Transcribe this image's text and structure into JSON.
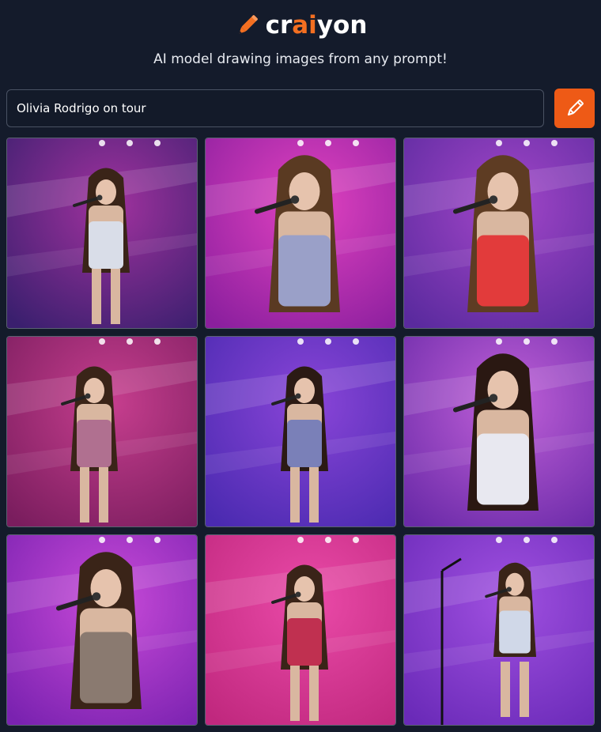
{
  "header": {
    "brand_prefix": "cr",
    "brand_ai": "ai",
    "brand_suffix": "yon",
    "tagline": "AI model drawing images from any prompt!",
    "logo_icon": "pencil-icon",
    "accent_color": "#f36f21"
  },
  "prompt": {
    "value": "Olivia Rodrigo on tour",
    "button_icon": "pencil-icon",
    "button_color": "#ee5a16"
  },
  "gallery": {
    "images": [
      {
        "id": "img-1",
        "bg": [
          "#3a1f6e",
          "#a0329e"
        ],
        "accent": "#c8d9f0",
        "pose": "standing",
        "hair": "#3a2418",
        "outfit": "#d9dde8"
      },
      {
        "id": "img-2",
        "bg": [
          "#8b1f9e",
          "#e142c0"
        ],
        "accent": "#ffffff",
        "pose": "closeup",
        "hair": "#5a3a22",
        "outfit": "#9aa0c8"
      },
      {
        "id": "img-3",
        "bg": [
          "#5a2a9e",
          "#a246c8"
        ],
        "accent": "#e23b3b",
        "pose": "closeup",
        "hair": "#5e3c23",
        "outfit": "#e23b3b"
      },
      {
        "id": "img-4",
        "bg": [
          "#7a1d5e",
          "#c63e8e"
        ],
        "accent": "#ffd0e0",
        "pose": "leaning",
        "hair": "#3a2418",
        "outfit": "#b07090"
      },
      {
        "id": "img-5",
        "bg": [
          "#4a2ab0",
          "#8a45d8"
        ],
        "accent": "#c9b8ff",
        "pose": "standing",
        "hair": "#2b1a14",
        "outfit": "#7a80b8"
      },
      {
        "id": "img-6",
        "bg": [
          "#6a2aa8",
          "#c060d8"
        ],
        "accent": "#f2f2f2",
        "pose": "closeup",
        "hair": "#2a1812",
        "outfit": "#e8e8f0"
      },
      {
        "id": "img-7",
        "bg": [
          "#7a22b0",
          "#c84ad8"
        ],
        "accent": "#e0e0e0",
        "pose": "closeup",
        "hair": "#3a2418",
        "outfit": "#8a7a70"
      },
      {
        "id": "img-8",
        "bg": [
          "#c0287e",
          "#ea4aa8"
        ],
        "accent": "#ffffff",
        "pose": "standing",
        "hair": "#3a2418",
        "outfit": "#c03050"
      },
      {
        "id": "img-9",
        "bg": [
          "#6a2ab8",
          "#a050e0"
        ],
        "accent": "#d8e0f0",
        "pose": "mic-stand",
        "hair": "#3a2418",
        "outfit": "#d0d8e8"
      }
    ]
  }
}
